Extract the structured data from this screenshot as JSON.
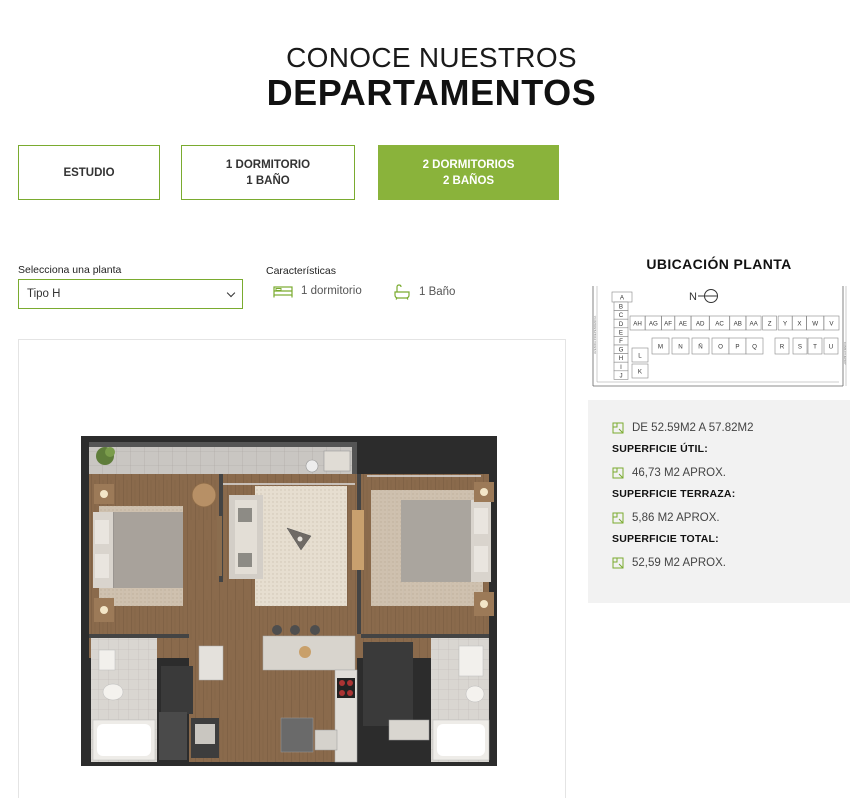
{
  "hero": {
    "line1": "CONOCE NUESTROS",
    "line2": "DEPARTAMENTOS"
  },
  "types": [
    {
      "label": "ESTUDIO",
      "active": false
    },
    {
      "label": "1 DORMITORIO\n1 BAÑO",
      "active": false
    },
    {
      "label": "2 DORMITORIOS\n2 BAÑOS",
      "active": true
    }
  ],
  "selector": {
    "label": "Selecciona una planta",
    "value": "Tipo H"
  },
  "features": {
    "label": "Características",
    "bedroom": "1 dormitorio",
    "bath": "1 Baño"
  },
  "location": {
    "title": "UBICACIÓN PLANTA",
    "north": "N",
    "street_left": "AVENIDA INDEPENDENCIA",
    "street_right": "CAMILO HENRY",
    "units_left": [
      "A",
      "B",
      "C",
      "D",
      "E",
      "F",
      "G",
      "H",
      "I",
      "J"
    ],
    "units_top": [
      "AH",
      "AG",
      "AF",
      "AE",
      "AD",
      "AC",
      "AB",
      "AA",
      "Z",
      "Y",
      "X",
      "W",
      "V"
    ],
    "units_bottom": [
      "M",
      "N",
      "Ñ",
      "O",
      "P",
      "Q",
      "R",
      "S",
      "T",
      "U"
    ],
    "units_inner": [
      "L",
      "K"
    ]
  },
  "surfaces": {
    "range": "DE 52.59M2 A 57.82M2",
    "util_label": "SUPERFICIE ÚTIL:",
    "util_value": "46,73 M2 APROX.",
    "terraza_label": "SUPERFICIE TERRAZA:",
    "terraza_value": "5,86 M2 APROX.",
    "total_label": "SUPERFICIE TOTAL:",
    "total_value": "52,59 M2 APROX."
  },
  "colors": {
    "accent": "#8ab33b",
    "border": "#7aab2f",
    "panel": "#f2f2f2"
  }
}
